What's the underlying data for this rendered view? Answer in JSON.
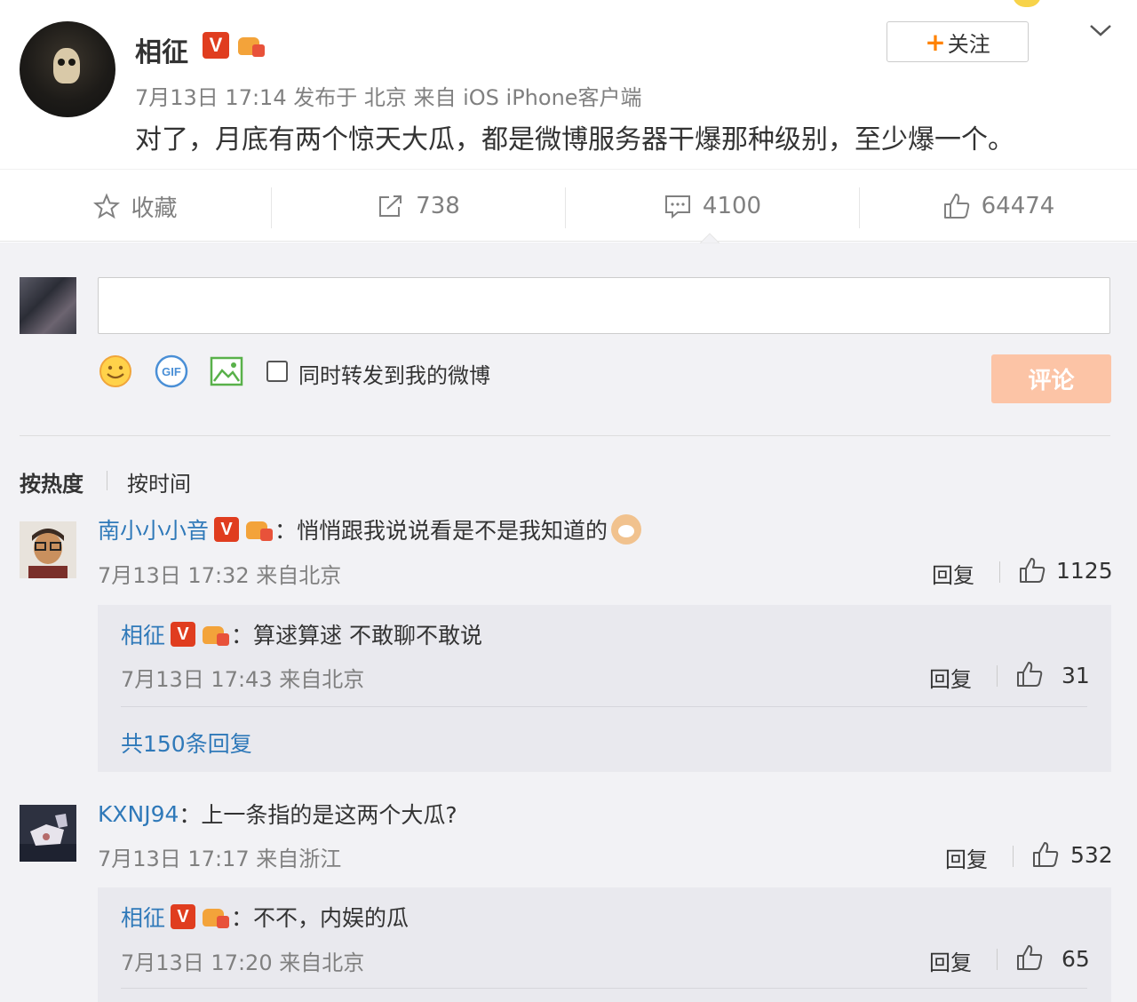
{
  "post": {
    "author": "相征",
    "meta": "7月13日 17:14 发布于 北京 来自 iOS iPhone客户端",
    "text": "对了，月底有两个惊天大瓜，都是微博服务器干爆那种级别，至少爆一个。",
    "follow_label": "关注",
    "verified_mark": "V"
  },
  "actions": {
    "favorite_label": "收藏",
    "repost_count": "738",
    "comment_count": "4100",
    "like_count": "64474"
  },
  "composer": {
    "repost_checkbox_label": "同时转发到我的微博",
    "submit_label": "评论",
    "gif_label": "GIF"
  },
  "sort": {
    "hot_label": "按热度",
    "time_label": "按时间"
  },
  "comments": [
    {
      "user": "南小小小音",
      "text": "：悄悄跟我说说看是不是我知道的",
      "time": "7月13日 17:32 来自北京",
      "reply_label": "回复",
      "likes": "1125",
      "replies": [
        {
          "user": "相征",
          "text": "：算逑算逑 不敢聊不敢说",
          "time": "7月13日 17:43 来自北京",
          "reply_label": "回复",
          "likes": "31"
        }
      ],
      "more_replies": "共150条回复"
    },
    {
      "user": "KXNJ94",
      "text": "：上一条指的是这两个大瓜?",
      "time": "7月13日 17:17 来自浙江",
      "reply_label": "回复",
      "likes": "532",
      "replies": [
        {
          "user": "相征",
          "text": "：不不，内娱的瓜",
          "time": "7月13日 17:20 来自北京",
          "reply_label": "回复",
          "likes": "65"
        }
      ]
    }
  ],
  "colors": {
    "accent_orange": "#ff8200",
    "username_blue": "#2f79b9",
    "submit_disabled": "#fcc4a6",
    "verified_red": "#e03d1f"
  }
}
